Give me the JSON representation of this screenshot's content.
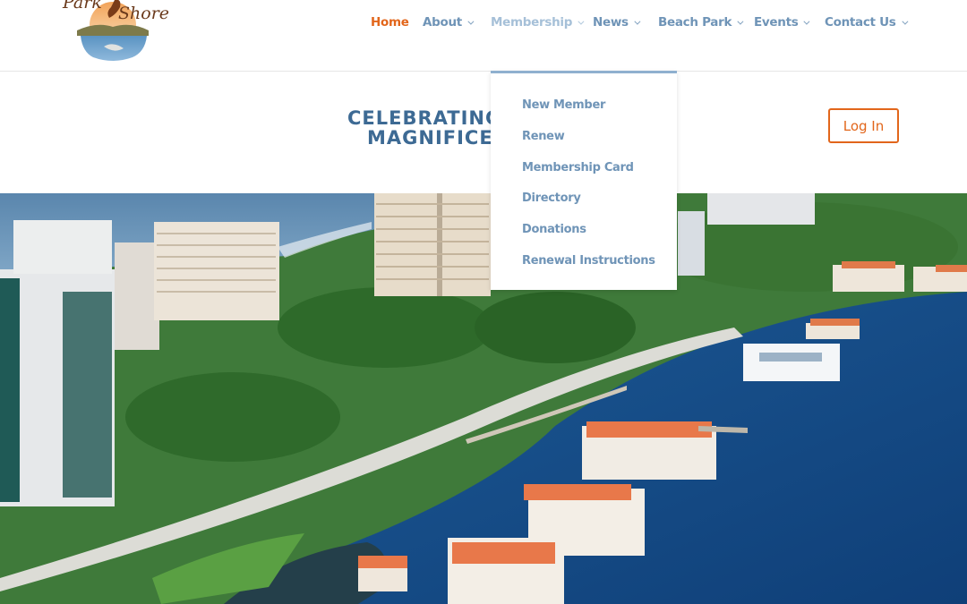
{
  "brand": {
    "logo_line1": "Park",
    "logo_line2": "Shore",
    "logo_ampersand": "&"
  },
  "nav": {
    "items": [
      {
        "label": "Home",
        "state": "active",
        "has_dropdown": false
      },
      {
        "label": "About",
        "state": "normal",
        "has_dropdown": true
      },
      {
        "label": "Membership",
        "state": "hover",
        "has_dropdown": true
      },
      {
        "label": "News",
        "state": "normal",
        "has_dropdown": true
      },
      {
        "label": "Beach Park",
        "state": "normal",
        "has_dropdown": true
      },
      {
        "label": "Events",
        "state": "normal",
        "has_dropdown": true
      },
      {
        "label": "Contact Us",
        "state": "normal",
        "has_dropdown": true
      }
    ]
  },
  "membership_menu": {
    "items": [
      {
        "label": "New Member"
      },
      {
        "label": "Renew"
      },
      {
        "label": "Membership Card"
      },
      {
        "label": "Directory"
      },
      {
        "label": "Donations"
      },
      {
        "label": "Renewal Instructions"
      }
    ]
  },
  "headline": {
    "line1": "CELEBRATING O",
    "line2": "MAGNIFICEN"
  },
  "login": {
    "label": "Log In"
  },
  "hero": {
    "alt": "Aerial view of Park Shore waterfront with high-rise condos, palm trees and bay"
  },
  "colors": {
    "accent": "#e2661b",
    "nav_text": "#6f94b7",
    "nav_hover": "#a6c0d8",
    "headline": "#3d6a94",
    "dropdown_border": "#8fb0cf"
  }
}
